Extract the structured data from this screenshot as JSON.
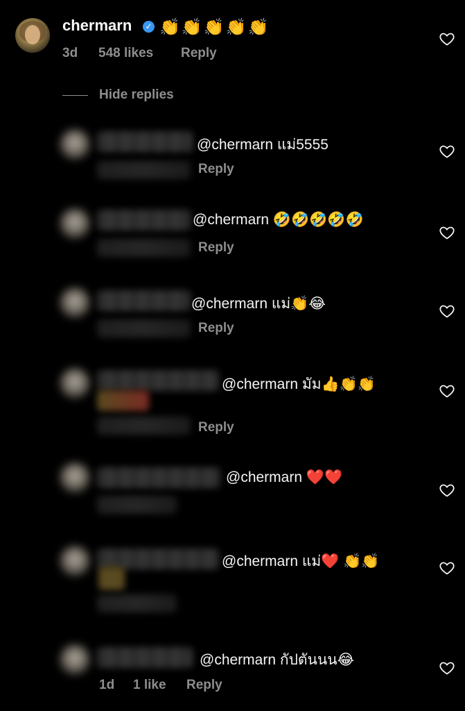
{
  "main_comment": {
    "username": "chermarn",
    "verified_mark": "✓",
    "emojis": "👏👏👏👏👏",
    "time": "3d",
    "likes": "548 likes",
    "reply_label": "Reply"
  },
  "hide_replies_label": "Hide replies",
  "replies": [
    {
      "text": "@chermarn แม่5555",
      "reply_label": "Reply"
    },
    {
      "text": "@chermarn 🤣🤣🤣🤣🤣",
      "reply_label": "Reply"
    },
    {
      "text": "@chermarn แม่👏😂",
      "reply_label": "Reply"
    },
    {
      "text": "@chermarn มัม👍👏👏",
      "reply_label": "Reply"
    },
    {
      "text": "@chermarn ❤️❤️"
    },
    {
      "text": "@chermarn แม่❤️ 👏👏"
    },
    {
      "text": "@chermarn กัปตันนน😂",
      "time": "1d",
      "likes": "1 like",
      "reply_label": "Reply"
    }
  ],
  "icons": {
    "like": "heart-outline-icon",
    "verified": "verified-badge-icon"
  },
  "colors": {
    "background": "#000000",
    "muted": "#8e8e8e",
    "verified": "#3897f0"
  }
}
